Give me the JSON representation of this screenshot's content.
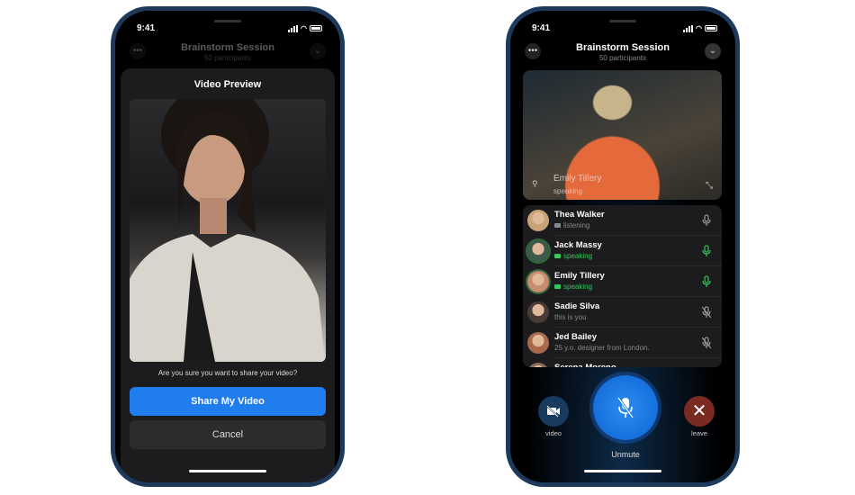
{
  "status": {
    "time": "9:41"
  },
  "session": {
    "title": "Brainstorm Session",
    "participants": "50 participants"
  },
  "left": {
    "sheet_title": "Video Preview",
    "question": "Are you sure you want to share your video?",
    "share_label": "Share My Video",
    "cancel_label": "Cancel"
  },
  "right": {
    "featured": {
      "name": "Emily Tillery",
      "status": "speaking"
    },
    "participants": [
      {
        "name": "Thea Walker",
        "status": "listening",
        "speaking": false,
        "muted": false
      },
      {
        "name": "Jack Massy",
        "status": "speaking",
        "speaking": true,
        "muted": false
      },
      {
        "name": "Emily Tillery",
        "status": "speaking",
        "speaking": true,
        "muted": false
      },
      {
        "name": "Sadie Silva",
        "status": "this is you",
        "speaking": false,
        "muted": true
      },
      {
        "name": "Jed Bailey",
        "status": "25 y.o. designer from London.",
        "speaking": false,
        "muted": true
      },
      {
        "name": "Serena Moreno",
        "status": "",
        "speaking": false,
        "muted": false
      }
    ],
    "controls": {
      "video_label": "video",
      "unmute_label": "Unmute",
      "leave_label": "leave"
    }
  },
  "colors": {
    "accent": "#1f7df0",
    "speaking": "#34c759",
    "leave": "#7a2a20",
    "video_btn": "#173a5e"
  },
  "icons": [
    "more-icon",
    "chevron-down-icon",
    "mic-icon",
    "mic-off-icon",
    "video-off-icon",
    "close-icon",
    "pin-icon",
    "expand-icon"
  ]
}
